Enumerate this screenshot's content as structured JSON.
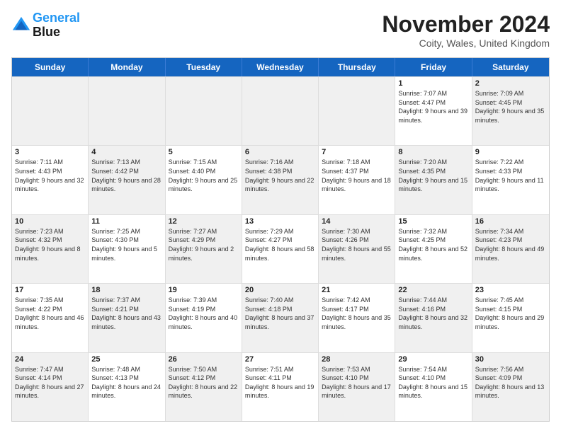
{
  "logo": {
    "line1": "General",
    "line2": "Blue"
  },
  "title": "November 2024",
  "location": "Coity, Wales, United Kingdom",
  "headers": [
    "Sunday",
    "Monday",
    "Tuesday",
    "Wednesday",
    "Thursday",
    "Friday",
    "Saturday"
  ],
  "weeks": [
    [
      {
        "day": "",
        "info": "",
        "shaded": true
      },
      {
        "day": "",
        "info": "",
        "shaded": true
      },
      {
        "day": "",
        "info": "",
        "shaded": true
      },
      {
        "day": "",
        "info": "",
        "shaded": true
      },
      {
        "day": "",
        "info": "",
        "shaded": true
      },
      {
        "day": "1",
        "info": "Sunrise: 7:07 AM\nSunset: 4:47 PM\nDaylight: 9 hours\nand 39 minutes."
      },
      {
        "day": "2",
        "info": "Sunrise: 7:09 AM\nSunset: 4:45 PM\nDaylight: 9 hours\nand 35 minutes.",
        "shaded": true
      }
    ],
    [
      {
        "day": "3",
        "info": "Sunrise: 7:11 AM\nSunset: 4:43 PM\nDaylight: 9 hours\nand 32 minutes."
      },
      {
        "day": "4",
        "info": "Sunrise: 7:13 AM\nSunset: 4:42 PM\nDaylight: 9 hours\nand 28 minutes.",
        "shaded": true
      },
      {
        "day": "5",
        "info": "Sunrise: 7:15 AM\nSunset: 4:40 PM\nDaylight: 9 hours\nand 25 minutes."
      },
      {
        "day": "6",
        "info": "Sunrise: 7:16 AM\nSunset: 4:38 PM\nDaylight: 9 hours\nand 22 minutes.",
        "shaded": true
      },
      {
        "day": "7",
        "info": "Sunrise: 7:18 AM\nSunset: 4:37 PM\nDaylight: 9 hours\nand 18 minutes."
      },
      {
        "day": "8",
        "info": "Sunrise: 7:20 AM\nSunset: 4:35 PM\nDaylight: 9 hours\nand 15 minutes.",
        "shaded": true
      },
      {
        "day": "9",
        "info": "Sunrise: 7:22 AM\nSunset: 4:33 PM\nDaylight: 9 hours\nand 11 minutes."
      }
    ],
    [
      {
        "day": "10",
        "info": "Sunrise: 7:23 AM\nSunset: 4:32 PM\nDaylight: 9 hours\nand 8 minutes.",
        "shaded": true
      },
      {
        "day": "11",
        "info": "Sunrise: 7:25 AM\nSunset: 4:30 PM\nDaylight: 9 hours\nand 5 minutes."
      },
      {
        "day": "12",
        "info": "Sunrise: 7:27 AM\nSunset: 4:29 PM\nDaylight: 9 hours\nand 2 minutes.",
        "shaded": true
      },
      {
        "day": "13",
        "info": "Sunrise: 7:29 AM\nSunset: 4:27 PM\nDaylight: 8 hours\nand 58 minutes."
      },
      {
        "day": "14",
        "info": "Sunrise: 7:30 AM\nSunset: 4:26 PM\nDaylight: 8 hours\nand 55 minutes.",
        "shaded": true
      },
      {
        "day": "15",
        "info": "Sunrise: 7:32 AM\nSunset: 4:25 PM\nDaylight: 8 hours\nand 52 minutes."
      },
      {
        "day": "16",
        "info": "Sunrise: 7:34 AM\nSunset: 4:23 PM\nDaylight: 8 hours\nand 49 minutes.",
        "shaded": true
      }
    ],
    [
      {
        "day": "17",
        "info": "Sunrise: 7:35 AM\nSunset: 4:22 PM\nDaylight: 8 hours\nand 46 minutes."
      },
      {
        "day": "18",
        "info": "Sunrise: 7:37 AM\nSunset: 4:21 PM\nDaylight: 8 hours\nand 43 minutes.",
        "shaded": true
      },
      {
        "day": "19",
        "info": "Sunrise: 7:39 AM\nSunset: 4:19 PM\nDaylight: 8 hours\nand 40 minutes."
      },
      {
        "day": "20",
        "info": "Sunrise: 7:40 AM\nSunset: 4:18 PM\nDaylight: 8 hours\nand 37 minutes.",
        "shaded": true
      },
      {
        "day": "21",
        "info": "Sunrise: 7:42 AM\nSunset: 4:17 PM\nDaylight: 8 hours\nand 35 minutes."
      },
      {
        "day": "22",
        "info": "Sunrise: 7:44 AM\nSunset: 4:16 PM\nDaylight: 8 hours\nand 32 minutes.",
        "shaded": true
      },
      {
        "day": "23",
        "info": "Sunrise: 7:45 AM\nSunset: 4:15 PM\nDaylight: 8 hours\nand 29 minutes."
      }
    ],
    [
      {
        "day": "24",
        "info": "Sunrise: 7:47 AM\nSunset: 4:14 PM\nDaylight: 8 hours\nand 27 minutes.",
        "shaded": true
      },
      {
        "day": "25",
        "info": "Sunrise: 7:48 AM\nSunset: 4:13 PM\nDaylight: 8 hours\nand 24 minutes."
      },
      {
        "day": "26",
        "info": "Sunrise: 7:50 AM\nSunset: 4:12 PM\nDaylight: 8 hours\nand 22 minutes.",
        "shaded": true
      },
      {
        "day": "27",
        "info": "Sunrise: 7:51 AM\nSunset: 4:11 PM\nDaylight: 8 hours\nand 19 minutes."
      },
      {
        "day": "28",
        "info": "Sunrise: 7:53 AM\nSunset: 4:10 PM\nDaylight: 8 hours\nand 17 minutes.",
        "shaded": true
      },
      {
        "day": "29",
        "info": "Sunrise: 7:54 AM\nSunset: 4:10 PM\nDaylight: 8 hours\nand 15 minutes."
      },
      {
        "day": "30",
        "info": "Sunrise: 7:56 AM\nSunset: 4:09 PM\nDaylight: 8 hours\nand 13 minutes.",
        "shaded": true
      }
    ]
  ]
}
